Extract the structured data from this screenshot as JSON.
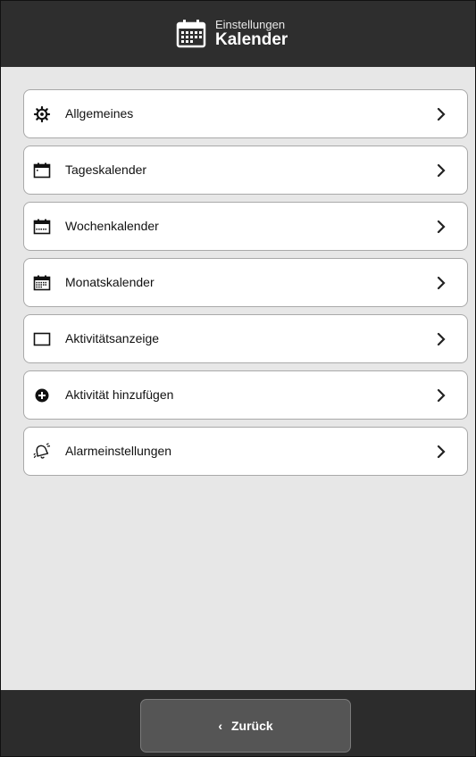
{
  "header": {
    "subtitle": "Einstellungen",
    "title": "Kalender",
    "icon": "calendar-grid-icon"
  },
  "menu": {
    "items": [
      {
        "label": "Allgemeines",
        "icon": "gear-icon"
      },
      {
        "label": "Tageskalender",
        "icon": "day-calendar-icon"
      },
      {
        "label": "Wochenkalender",
        "icon": "week-calendar-icon"
      },
      {
        "label": "Monatskalender",
        "icon": "month-calendar-icon"
      },
      {
        "label": "Aktivitätsanzeige",
        "icon": "activity-display-icon"
      },
      {
        "label": "Aktivität hinzufügen",
        "icon": "add-activity-icon"
      },
      {
        "label": "Alarmeinstellungen",
        "icon": "alarm-settings-icon"
      }
    ]
  },
  "footer": {
    "back_label": "Zurück",
    "back_icon": "chevron-left-icon"
  },
  "colors": {
    "header_bg": "#2e2e2e",
    "page_bg": "#e7e7e7",
    "item_bg": "#ffffff",
    "item_border": "#a9a9a9",
    "button_bg": "#555555"
  }
}
